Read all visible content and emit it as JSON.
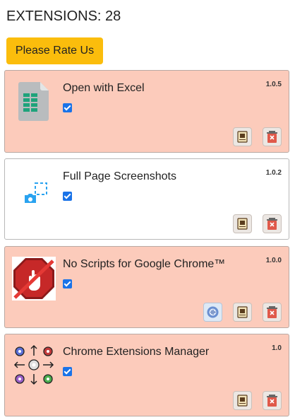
{
  "header": {
    "title": "EXTENSIONS: 28",
    "rate_label": "Please Rate Us"
  },
  "extensions": [
    {
      "name": "Open with Excel",
      "version": "1.0.5",
      "enabled": true,
      "icon": "excel-doc-icon"
    },
    {
      "name": "Full Page Screenshots",
      "version": "1.0.2",
      "enabled": true,
      "icon": "screenshot-camera-icon"
    },
    {
      "name": "No Scripts for Google Chrome™",
      "version": "1.0.0",
      "enabled": true,
      "icon": "stop-hand-icon"
    },
    {
      "name": "Chrome Extensions Manager",
      "version": "1.0",
      "enabled": true,
      "icon": "gears-icon"
    }
  ],
  "colors": {
    "card_off": "#fccbbb",
    "card_on": "#ffffff",
    "rate_button": "#fbbd0c",
    "checkbox": "#1a73e8"
  },
  "action_icons": [
    "options-icon",
    "details-scroll-icon",
    "delete-trash-icon"
  ]
}
